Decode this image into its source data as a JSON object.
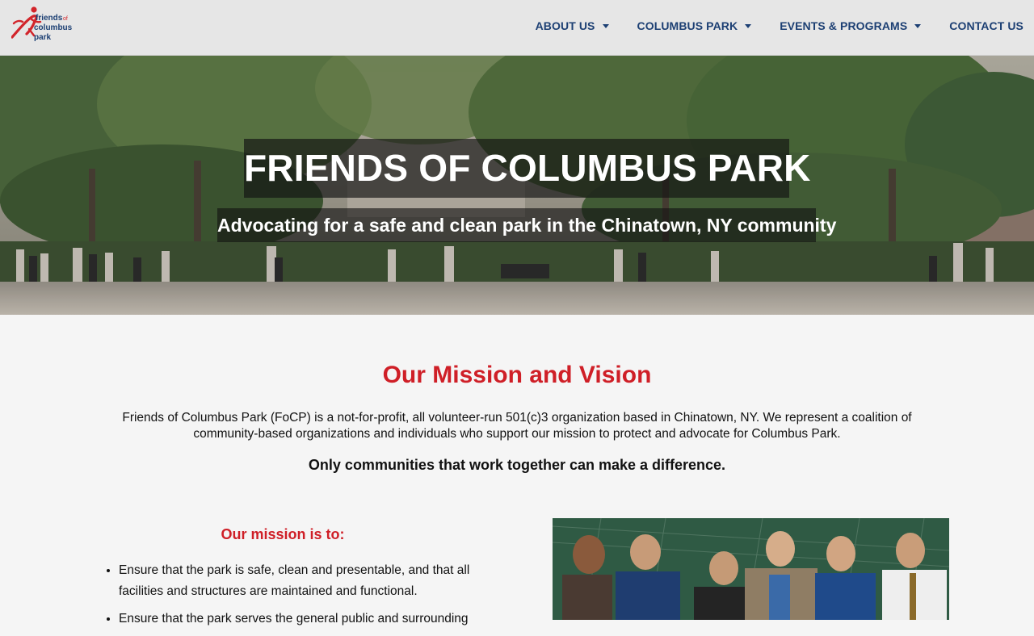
{
  "header": {
    "logo_alt": "friends of columbus park",
    "nav": [
      {
        "label": "ABOUT US",
        "has_dropdown": true
      },
      {
        "label": "COLUMBUS PARK",
        "has_dropdown": true
      },
      {
        "label": "EVENTS & PROGRAMS",
        "has_dropdown": true
      },
      {
        "label": "CONTACT US",
        "has_dropdown": false
      }
    ]
  },
  "hero": {
    "title": "FRIENDS OF COLUMBUS PARK",
    "subtitle": "Advocating for a safe and clean park in the Chinatown, NY community"
  },
  "mission": {
    "heading": "Our Mission and Vision",
    "body": "Friends of Columbus Park (FoCP) is a not-for-profit, all volunteer-run 501(c)3 organization based in Chinatown, NY. We represent a coalition of community-based organizations and individuals who support our mission to protect and advocate for Columbus Park.",
    "tagline": "Only communities that work together can make a difference.",
    "list_heading": "Our mission is to:",
    "items": [
      "Ensure that the park is safe, clean and presentable, and that all facilities and structures are maintained and functional.",
      "Ensure that the park serves the general public and surrounding"
    ]
  },
  "colors": {
    "nav_text": "#1c3f73",
    "accent_red": "#cf1f27",
    "header_bg": "#e6e6e6",
    "page_bg": "#f5f5f5"
  },
  "icons": {
    "nav_dropdown": "caret-down-icon",
    "logo": "running-figure-logo"
  }
}
